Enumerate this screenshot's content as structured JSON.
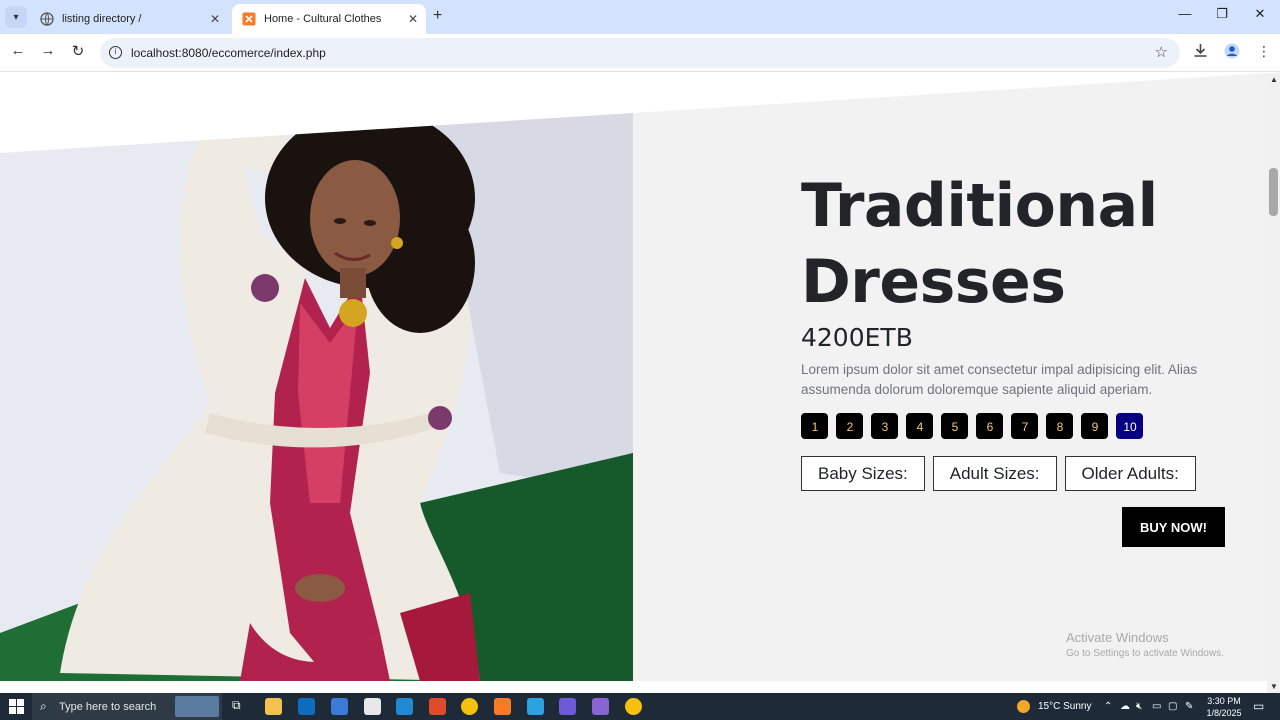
{
  "browser": {
    "tabs": [
      {
        "title": "listing directory /",
        "active": false
      },
      {
        "title": "Home - Cultural Clothes",
        "active": true
      }
    ],
    "url": "localhost:8080/eccomerce/index.php"
  },
  "product": {
    "title": "Traditional Dresses",
    "price": "4200ETB",
    "description": "Lorem ipsum dolor sit amet consectetur impal adipisicing elit. Alias assumenda dolorum doloremque sapiente aliquid aperiam.",
    "quantities": [
      "1",
      "2",
      "3",
      "4",
      "5",
      "6",
      "7",
      "8",
      "9",
      "10"
    ],
    "selected_quantity": "10",
    "sizes": [
      "Baby Sizes:",
      "Adult Sizes:",
      "Older Adults:"
    ],
    "buy_label": "BUY NOW!"
  },
  "watermark": {
    "line1": "Activate Windows",
    "line2": "Go to Settings to activate Windows."
  },
  "taskbar": {
    "search_placeholder": "Type here to search",
    "weather": "15°C  Sunny",
    "time": "3:30 PM",
    "date": "1/8/2025"
  },
  "colors": {
    "accent_quantity": "#060081",
    "quantity_text": "#f7c66b",
    "page_bg": "#f2f2f2"
  }
}
